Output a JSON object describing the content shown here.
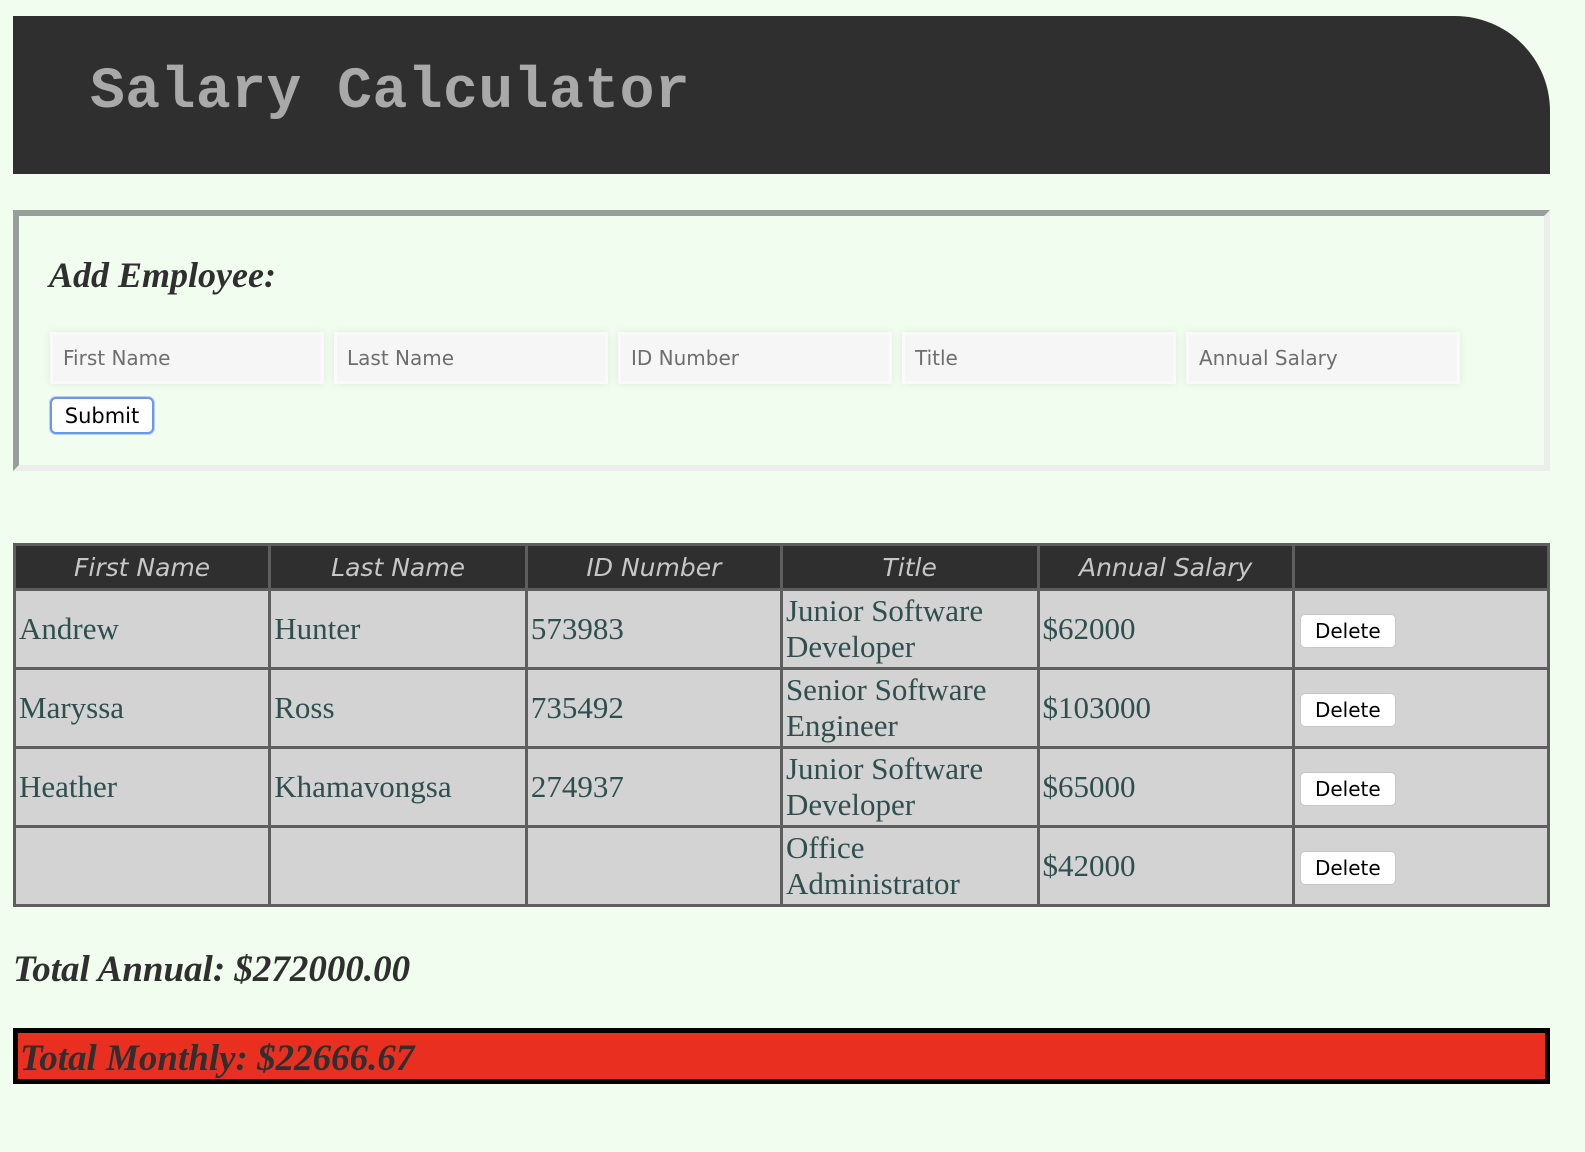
{
  "header": {
    "title": "Salary Calculator"
  },
  "form": {
    "heading": "Add Employee:",
    "fields": {
      "first_name_placeholder": "First Name",
      "last_name_placeholder": "Last Name",
      "id_number_placeholder": "ID Number",
      "title_placeholder": "Title",
      "annual_salary_placeholder": "Annual Salary"
    },
    "submit_label": "Submit"
  },
  "table": {
    "headers": [
      "First Name",
      "Last Name",
      "ID Number",
      "Title",
      "Annual Salary",
      ""
    ],
    "rows": [
      {
        "first_name": "Andrew",
        "last_name": "Hunter",
        "id_number": "573983",
        "title": "Junior Software Developer",
        "salary": "$62000",
        "delete_label": "Delete"
      },
      {
        "first_name": "Maryssa",
        "last_name": "Ross",
        "id_number": "735492",
        "title": "Senior Software Engineer",
        "salary": "$103000",
        "delete_label": "Delete"
      },
      {
        "first_name": "Heather",
        "last_name": "Khamavongsa",
        "id_number": "274937",
        "title": "Junior Software Developer",
        "salary": "$65000",
        "delete_label": "Delete"
      },
      {
        "first_name": "",
        "last_name": "",
        "id_number": "",
        "title": "Office Administrator",
        "salary": "$42000",
        "delete_label": "Delete"
      }
    ]
  },
  "totals": {
    "annual": "Total Annual: $272000.00",
    "monthly": "Total Monthly: $22666.67",
    "monthly_alert_color": "#e93020"
  },
  "colors": {
    "background": "#f1fdef",
    "header_bg": "#2f2f2f",
    "header_text": "#a9a9a9",
    "table_cell_bg": "#d3d3d3"
  }
}
